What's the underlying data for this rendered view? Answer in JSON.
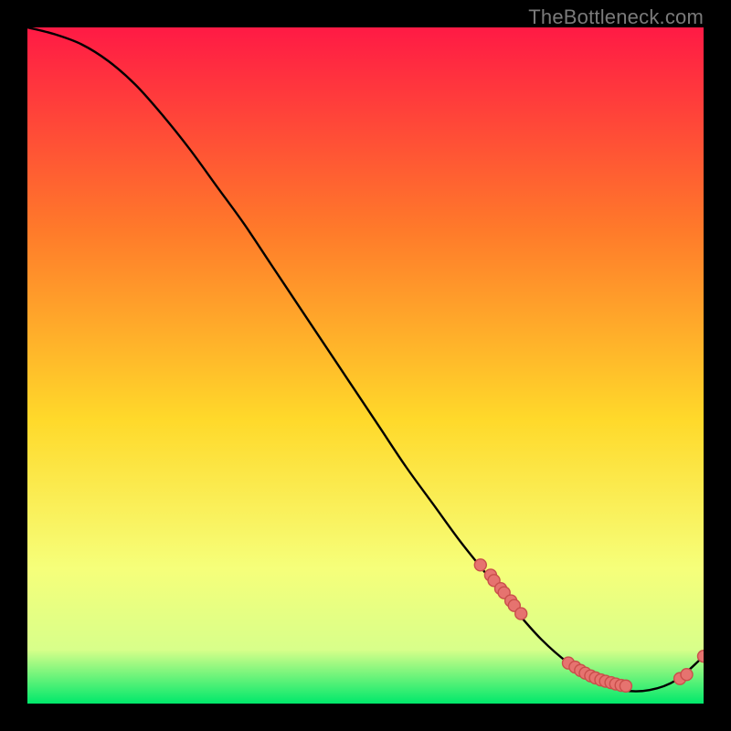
{
  "watermark": {
    "text": "TheBottleneck.com"
  },
  "colors": {
    "background_black": "#000000",
    "gradient_top": "#ff1a45",
    "gradient_mid_upper": "#ff7a2a",
    "gradient_mid": "#ffd92a",
    "gradient_lower": "#f6ff7a",
    "gradient_bottom": "#00e86b",
    "curve_stroke": "#000000",
    "marker_fill": "#e6736f",
    "marker_stroke": "#c94f4b"
  },
  "chart_data": {
    "type": "line",
    "title": "",
    "xlabel": "",
    "ylabel": "",
    "xlim": [
      0,
      100
    ],
    "ylim": [
      0,
      100
    ],
    "grid": false,
    "legend": false,
    "series": [
      {
        "name": "curve",
        "x": [
          0,
          4,
          8,
          12,
          16,
          20,
          24,
          28,
          32,
          36,
          40,
          44,
          48,
          52,
          56,
          60,
          64,
          68,
          72,
          76,
          80,
          84,
          88,
          92,
          96,
          100
        ],
        "y": [
          100,
          99,
          97.5,
          95,
          91.5,
          87,
          82,
          76.5,
          71,
          65,
          59,
          53,
          47,
          41,
          35,
          29.5,
          24,
          19,
          14,
          9.5,
          6,
          3.5,
          2,
          2,
          3.5,
          7
        ],
        "stroke": "#000000",
        "markers": false
      },
      {
        "name": "markers-left-cluster",
        "x": [
          67,
          68.5,
          69,
          70,
          70.5,
          71.5,
          72,
          73
        ],
        "y": [
          20.5,
          19,
          18.2,
          17,
          16.4,
          15.2,
          14.5,
          13.3
        ],
        "stroke": null,
        "markers": true
      },
      {
        "name": "markers-bottom-cluster",
        "x": [
          80,
          81,
          81.8,
          82.5,
          83.3,
          84,
          84.8,
          85.5,
          86.3,
          87,
          87.8,
          88.5
        ],
        "y": [
          6.0,
          5.4,
          4.9,
          4.5,
          4.1,
          3.8,
          3.5,
          3.3,
          3.1,
          2.9,
          2.7,
          2.6
        ],
        "stroke": null,
        "markers": true
      },
      {
        "name": "markers-right-cluster",
        "x": [
          96.5,
          97.5,
          100
        ],
        "y": [
          3.7,
          4.3,
          7.0
        ],
        "stroke": null,
        "markers": true
      }
    ]
  }
}
